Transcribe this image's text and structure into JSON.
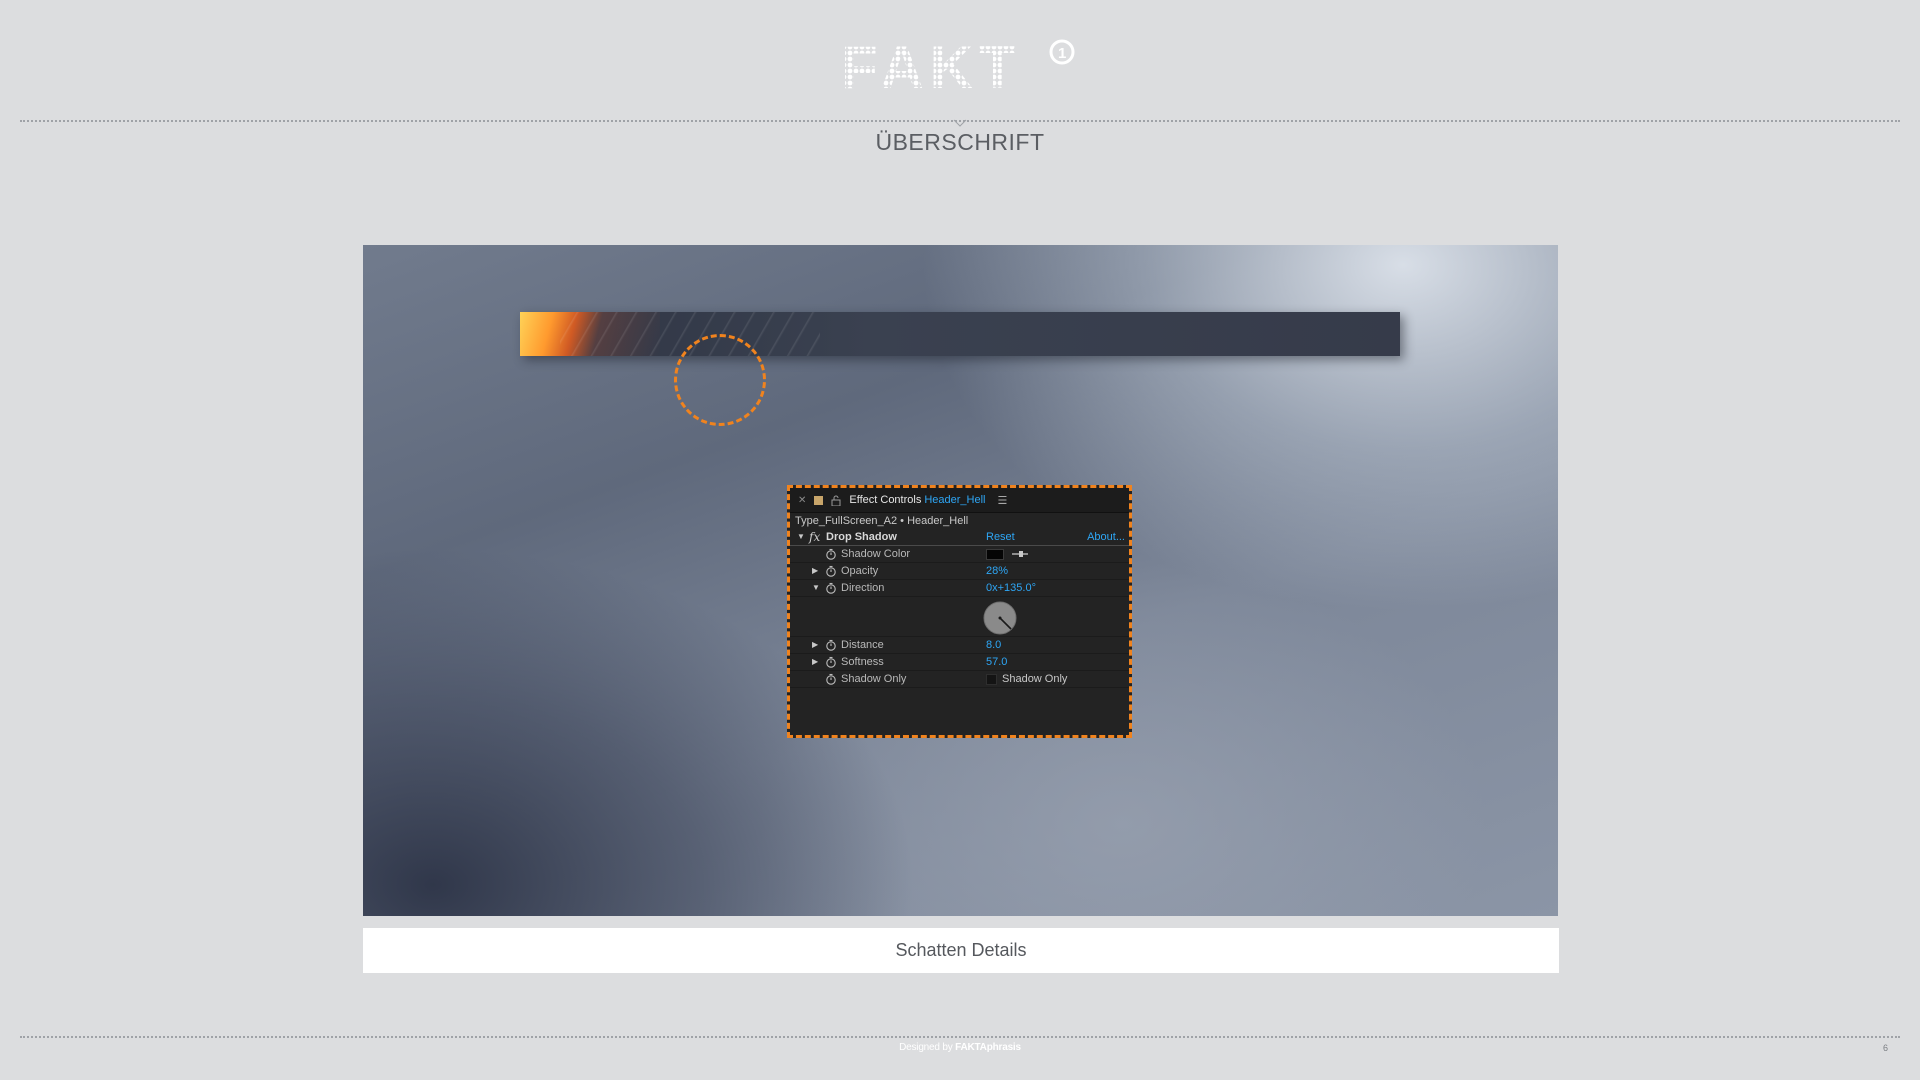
{
  "brand": {
    "logo_text": "FAKT",
    "logo_badge": "1"
  },
  "headline": "ÜBERSCHRIFT",
  "effect_panel": {
    "tab_prefix": "Effect Controls",
    "tab_comp": "Header_Hell",
    "breadcrumb": "Type_FullScreen_A2 • Header_Hell",
    "effect_name": "Drop Shadow",
    "reset": "Reset",
    "about": "About...",
    "properties": {
      "shadow_color": {
        "label": "Shadow Color",
        "value": "#050505"
      },
      "opacity": {
        "label": "Opacity",
        "value": "28%"
      },
      "direction": {
        "label": "Direction",
        "value": "0x+135.0°"
      },
      "distance": {
        "label": "Distance",
        "value": "8.0"
      },
      "softness": {
        "label": "Softness",
        "value": "57.0"
      },
      "shadow_only": {
        "label": "Shadow Only",
        "checkbox_label": "Shadow Only",
        "checked": false
      }
    }
  },
  "caption": "Schatten Details",
  "footer": {
    "credit_prefix": "Designed by",
    "credit_name": "FAKTAphrasis"
  },
  "page_number": "6",
  "colors": {
    "accent": "#f0831e",
    "link_blue": "#2ea6f5",
    "panel_bg": "#232323",
    "page_bg": "#dcdddf"
  }
}
